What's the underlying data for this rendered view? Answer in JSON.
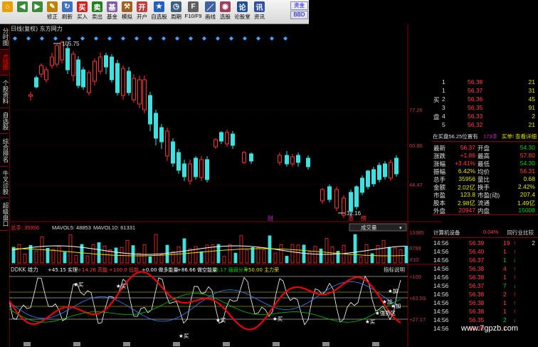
{
  "toolbar": {
    "buttons": [
      {
        "icon": "home-icon",
        "label": "",
        "color": "#e8a000"
      },
      {
        "icon": "back-icon",
        "label": "",
        "color": "#3a8a3a"
      },
      {
        "icon": "forward-icon",
        "label": "",
        "color": "#3a8a3a"
      },
      {
        "icon": "modify-icon",
        "label": "修正",
        "color": "#c08000"
      },
      {
        "icon": "refresh-icon",
        "label": "刷新",
        "color": "#4070c0"
      },
      {
        "icon": "buy-icon",
        "label": "买入",
        "color": "#d02020"
      },
      {
        "icon": "sell-icon",
        "label": "卖出",
        "color": "#208020"
      },
      {
        "icon": "fund-icon",
        "label": "基金",
        "color": "#8060a0"
      },
      {
        "icon": "simulate-icon",
        "label": "模拟",
        "color": "#a06020"
      },
      {
        "icon": "open-account-icon",
        "label": "开户",
        "color": "#c04040"
      },
      {
        "icon": "watchlist-icon",
        "label": "自选股",
        "color": "#2060c0"
      },
      {
        "icon": "period-icon",
        "label": "周期",
        "color": "#406080"
      },
      {
        "icon": "f10-icon",
        "label": "F10/F9",
        "color": "#606060"
      },
      {
        "icon": "draw-icon",
        "label": "画线",
        "color": "#4060a0"
      },
      {
        "icon": "stock-pick-icon",
        "label": "选股",
        "color": "#a04060"
      },
      {
        "icon": "research-icon",
        "label": "论股堂",
        "color": "#205090"
      },
      {
        "icon": "news-icon",
        "label": "资讯",
        "color": "#3050a0"
      }
    ],
    "right_top": "资金",
    "right_bottom": "BBD"
  },
  "sidebar": {
    "tabs": [
      "分时图",
      "K线图",
      "个股资料",
      "自选股",
      "综合排名",
      "牛叉诊股",
      "超级盘口"
    ],
    "active_index": 1
  },
  "chart": {
    "title": "日线(复权) 东方网力",
    "high_label": "105.75",
    "low_label": "32.16",
    "price_ticks": [
      "77.26",
      "60.86",
      "44.47"
    ],
    "markers": [
      "财",
      "涨",
      "榜"
    ]
  },
  "volume": {
    "label_total": "总手: 35956",
    "label_ma5": "MAVOL5: 48853",
    "label_ma10": "MAVOL10: 61331",
    "dropdown": "成交量",
    "ticks": [
      "13385",
      "6799",
      "X10"
    ]
  },
  "indicator": {
    "name": "DDKK 雄力",
    "values": [
      {
        "text": "+45.15 实理",
        "color": "#ffffff"
      },
      {
        "text": "+14.26 高能",
        "color": "#ff4040"
      },
      {
        "text": "+100.0 低能",
        "color": "#ff4040"
      },
      {
        "text": "+0.00 做多能量",
        "color": "#ffffff"
      },
      {
        "text": "+86.66 做空能量",
        "color": "#ffffff"
      },
      {
        "text": "+5.17 强弱分界",
        "color": "#00d000"
      },
      {
        "text": "+50.00 主力荣",
        "color": "#e0e000"
      }
    ],
    "help": "指标说明",
    "ticks": [
      "+100",
      "+63.59",
      "+27.17"
    ],
    "signals": [
      "加",
      "加",
      "加",
      "强势区",
      "买",
      "买",
      "买",
      "买",
      "买",
      "买"
    ]
  },
  "order_book": {
    "rows": [
      {
        "side": "",
        "level": "1",
        "price": "56.38",
        "vol": "21",
        "pc": "#ff4040"
      },
      {
        "side": "",
        "level": "1",
        "price": "56.37",
        "vol": "31",
        "pc": "#ff4040"
      },
      {
        "side": "买",
        "level": "2",
        "price": "56.36",
        "vol": "45",
        "pc": "#ff4040"
      },
      {
        "side": "",
        "level": "3",
        "price": "56.35",
        "vol": "91",
        "pc": "#ff4040"
      },
      {
        "side": "盘",
        "level": "4",
        "price": "56.33",
        "vol": "2",
        "pc": "#ff4040"
      },
      {
        "side": "",
        "level": "5",
        "price": "56.32",
        "vol": "21",
        "pc": "#ff4040"
      }
    ],
    "summary": "在买盘56.25位置有",
    "summary_count": "173手",
    "summary_link": "买单! 查看详细"
  },
  "quote": {
    "rows": [
      {
        "l1": "最新",
        "v1": "56.37",
        "c1": "#ff4040",
        "l2": "开盘",
        "v2": "54.30",
        "c2": "#00d000"
      },
      {
        "l1": "涨跌",
        "v1": "+1.86",
        "c1": "#ff4040",
        "l2": "最高",
        "v2": "57.80",
        "c2": "#ff4040"
      },
      {
        "l1": "涨幅",
        "v1": "+3.41%",
        "c1": "#ff4040",
        "l2": "最低",
        "v2": "54.30",
        "c2": "#00d000"
      },
      {
        "l1": "振幅",
        "v1": "6.42%",
        "c1": "#e0e000",
        "l2": "均价",
        "v2": "56.31",
        "c2": "#ff4040"
      },
      {
        "l1": "总手",
        "v1": "35956",
        "c1": "#e0e000",
        "l2": "量比",
        "v2": "0.68",
        "c2": "#e0e000"
      },
      {
        "l1": "金额",
        "v1": "2.02亿",
        "c1": "#e0e000",
        "l2": "换手",
        "v2": "2.42%",
        "c2": "#e0e000"
      },
      {
        "l1": "市盈",
        "v1": "123.8",
        "c1": "#e0e000",
        "l2": "市盈(动)",
        "v2": "207.4",
        "c2": "#e0e000"
      },
      {
        "l1": "股本",
        "v1": "2.98亿",
        "c1": "#e0e000",
        "l2": "流通",
        "v2": "1.49亿",
        "c2": "#e0e000"
      },
      {
        "l1": "外盘",
        "v1": "20947",
        "c1": "#ff4040",
        "l2": "内盘",
        "v2": "15008",
        "c2": "#00d000"
      }
    ]
  },
  "sector": {
    "name": "计算机设备",
    "change": "0.04%",
    "link": "同行业比较"
  },
  "ticks": {
    "rows": [
      {
        "time": "14:56",
        "price": "56.39",
        "vol": "19",
        "dir": "up",
        "tail": "2",
        "pc": "#ff4040"
      },
      {
        "time": "14:56",
        "price": "56.40",
        "vol": "1",
        "dir": "up",
        "tail": "",
        "pc": "#ff4040"
      },
      {
        "time": "14:56",
        "price": "56.37",
        "vol": "1",
        "dir": "down",
        "tail": "",
        "pc": "#ff4040"
      },
      {
        "time": "14:56",
        "price": "56.38",
        "vol": "4",
        "dir": "up",
        "tail": "",
        "pc": "#ff4040"
      },
      {
        "time": "14:56",
        "price": "56.38",
        "vol": "1",
        "dir": "up",
        "tail": "",
        "pc": "#ff4040"
      },
      {
        "time": "14:56",
        "price": "56.37",
        "vol": "7",
        "dir": "down",
        "tail": "",
        "pc": "#ff4040"
      },
      {
        "time": "14:56",
        "price": "56.38",
        "vol": "2",
        "dir": "up",
        "tail": "",
        "pc": "#ff4040"
      },
      {
        "time": "14:56",
        "price": "56.38",
        "vol": "1",
        "dir": "up",
        "tail": "",
        "pc": "#ff4040"
      },
      {
        "time": "14:56",
        "price": "56.38",
        "vol": "1",
        "dir": "up",
        "tail": "",
        "pc": "#ff4040"
      },
      {
        "time": "14:56",
        "price": "56.35",
        "vol": "2",
        "dir": "down",
        "tail": "",
        "pc": "#ff4040"
      },
      {
        "time": "14:56",
        "price": "56.38",
        "vol": "1",
        "dir": "up",
        "tail": "",
        "pc": "#ff4040"
      }
    ]
  },
  "watermark": "www.7gpzb.com"
}
